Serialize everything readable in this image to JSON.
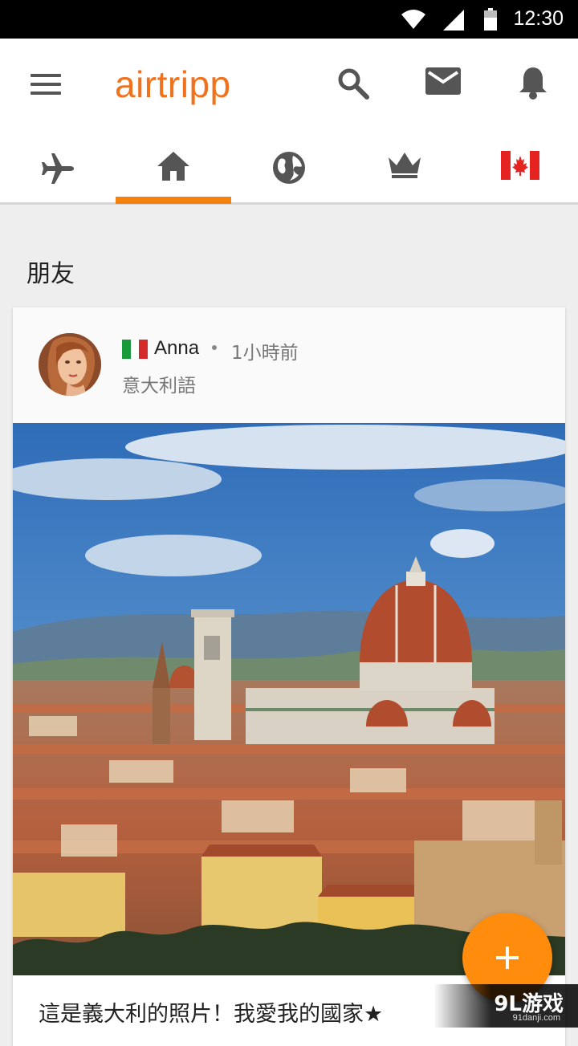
{
  "status_bar": {
    "time": "12:30"
  },
  "app": {
    "logo": "airtripp"
  },
  "header_icons": [
    "menu-icon",
    "search-icon",
    "mail-icon",
    "bell-icon"
  ],
  "tabs": [
    {
      "icon": "airplane-icon",
      "active": false
    },
    {
      "icon": "home-icon",
      "active": true
    },
    {
      "icon": "globe-icon",
      "active": false
    },
    {
      "icon": "crown-icon",
      "active": false
    },
    {
      "icon": "canada-flag-icon",
      "active": false
    }
  ],
  "section": {
    "title": "朋友"
  },
  "post": {
    "author": "Anna",
    "time_ago": "1小時前",
    "language": "意大利語",
    "caption": "這是義大利的照片！我愛我的國家★"
  },
  "fab": {
    "label": "+"
  },
  "watermark": {
    "main": "9L游戏",
    "sub": "91danji.com"
  },
  "colors": {
    "accent": "#f0721d",
    "fab": "#ff8c0c",
    "tab_indicator": "#f5820f"
  }
}
